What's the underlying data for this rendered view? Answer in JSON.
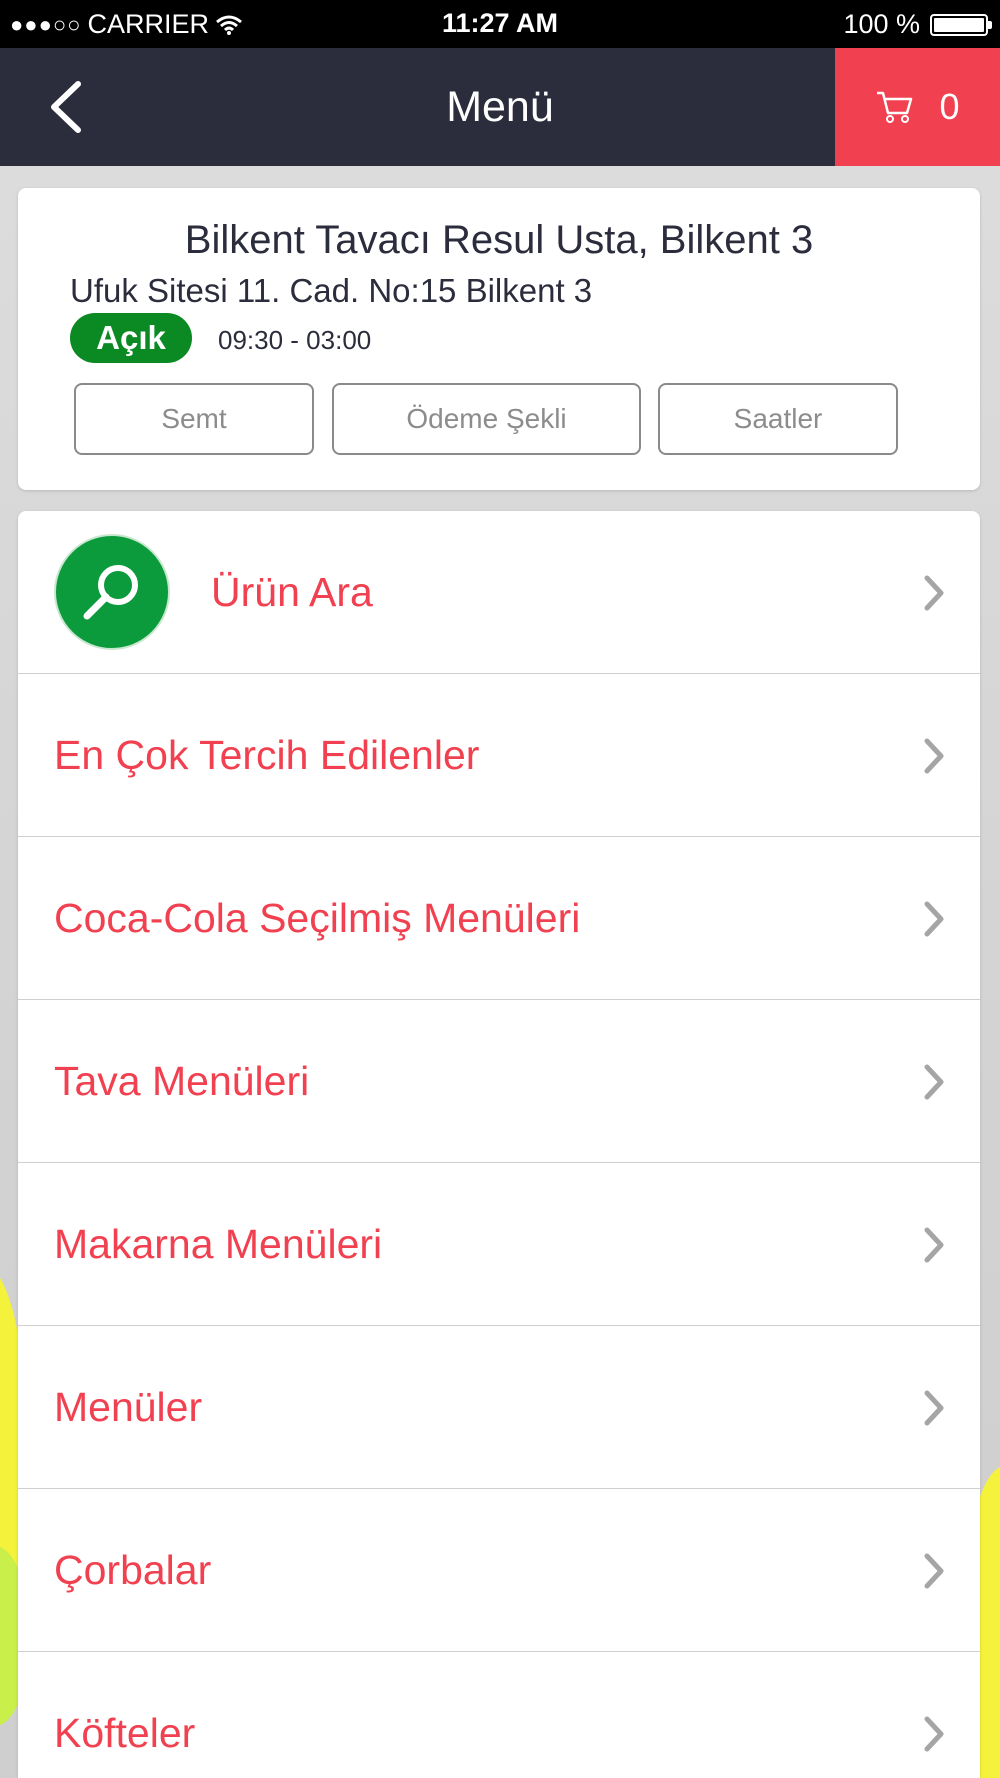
{
  "status_bar": {
    "signal_dots": "●●●○○",
    "carrier": "CARRIER",
    "time": "11:27 AM",
    "battery_text": "100 %",
    "battery_level": 1.0
  },
  "nav": {
    "back_icon": "chevron-left-icon",
    "title": "Menü",
    "cart_icon": "cart-icon",
    "cart_count": "0"
  },
  "store": {
    "name": "Bilkent Tavacı Resul Usta, Bilkent 3",
    "address": "Ufuk Sitesi 11. Cad. No:15 Bilkent 3",
    "status": "Açık",
    "hours": "09:30 - 03:00",
    "buttons": [
      "Semt",
      "Ödeme Şekli",
      "Saatler"
    ]
  },
  "menu": {
    "search_label": "Ürün Ara",
    "items": [
      "En Çok Tercih Edilenler",
      "Coca-Cola Seçilmiş Menüleri",
      "Tava Menüleri",
      "Makarna Menüleri",
      "Menüler",
      "Çorbalar",
      "Köfteler"
    ]
  },
  "colors": {
    "navbar": "#2b2c3c",
    "accent": "#f1404f",
    "open_status": "#0b8a24",
    "search_green": "#0b9a3c"
  }
}
